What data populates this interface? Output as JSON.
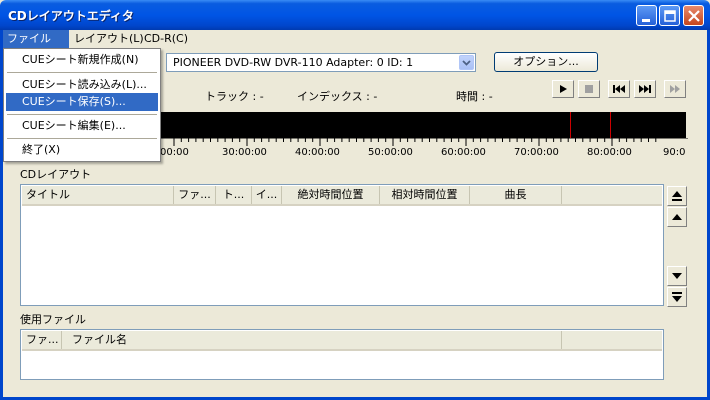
{
  "window": {
    "title": "CDレイアウトエディタ"
  },
  "menubar": {
    "file": "ファイル(F)",
    "layout": "レイアウト(L)",
    "cdr": "CD-R(C)"
  },
  "file_menu": {
    "new_cue": "CUEシート新規作成(N)",
    "load_cue": "CUEシート読み込み(L)...",
    "save_cue": "CUEシート保存(S)...",
    "edit_cue": "CUEシート編集(E)...",
    "exit": "終了(X)"
  },
  "drive": {
    "selected": "PIONEER DVD-RW  DVR-110   Adapter: 0  ID: 1"
  },
  "option_button": "オプション...",
  "status": {
    "track": "トラック : -",
    "index": "インデックス : -",
    "time": "時間 : -"
  },
  "transport": {
    "play": "play-icon",
    "stop": "stop-icon",
    "prev": "prev-track-icon",
    "next": "next-track-icon",
    "forward": "fast-forward-icon"
  },
  "timeline": {
    "ticks": [
      "00:00",
      "30:00:00",
      "40:00:00",
      "50:00:00",
      "60:00:00",
      "70:00:00",
      "80:00:00",
      "90:0"
    ],
    "marker_color": "#cc0000"
  },
  "layout_group": {
    "label": "CDレイアウト",
    "columns": [
      "タイトル",
      "ファ...",
      "ト...",
      "イ...",
      "絶対時間位置",
      "相対時間位置",
      "曲長"
    ]
  },
  "files_group": {
    "label": "使用ファイル",
    "columns": [
      "ファ...",
      "ファイル名"
    ]
  },
  "colors": {
    "titlebar": "#0055e5",
    "highlight": "#316ac5",
    "background": "#ece9d8"
  }
}
